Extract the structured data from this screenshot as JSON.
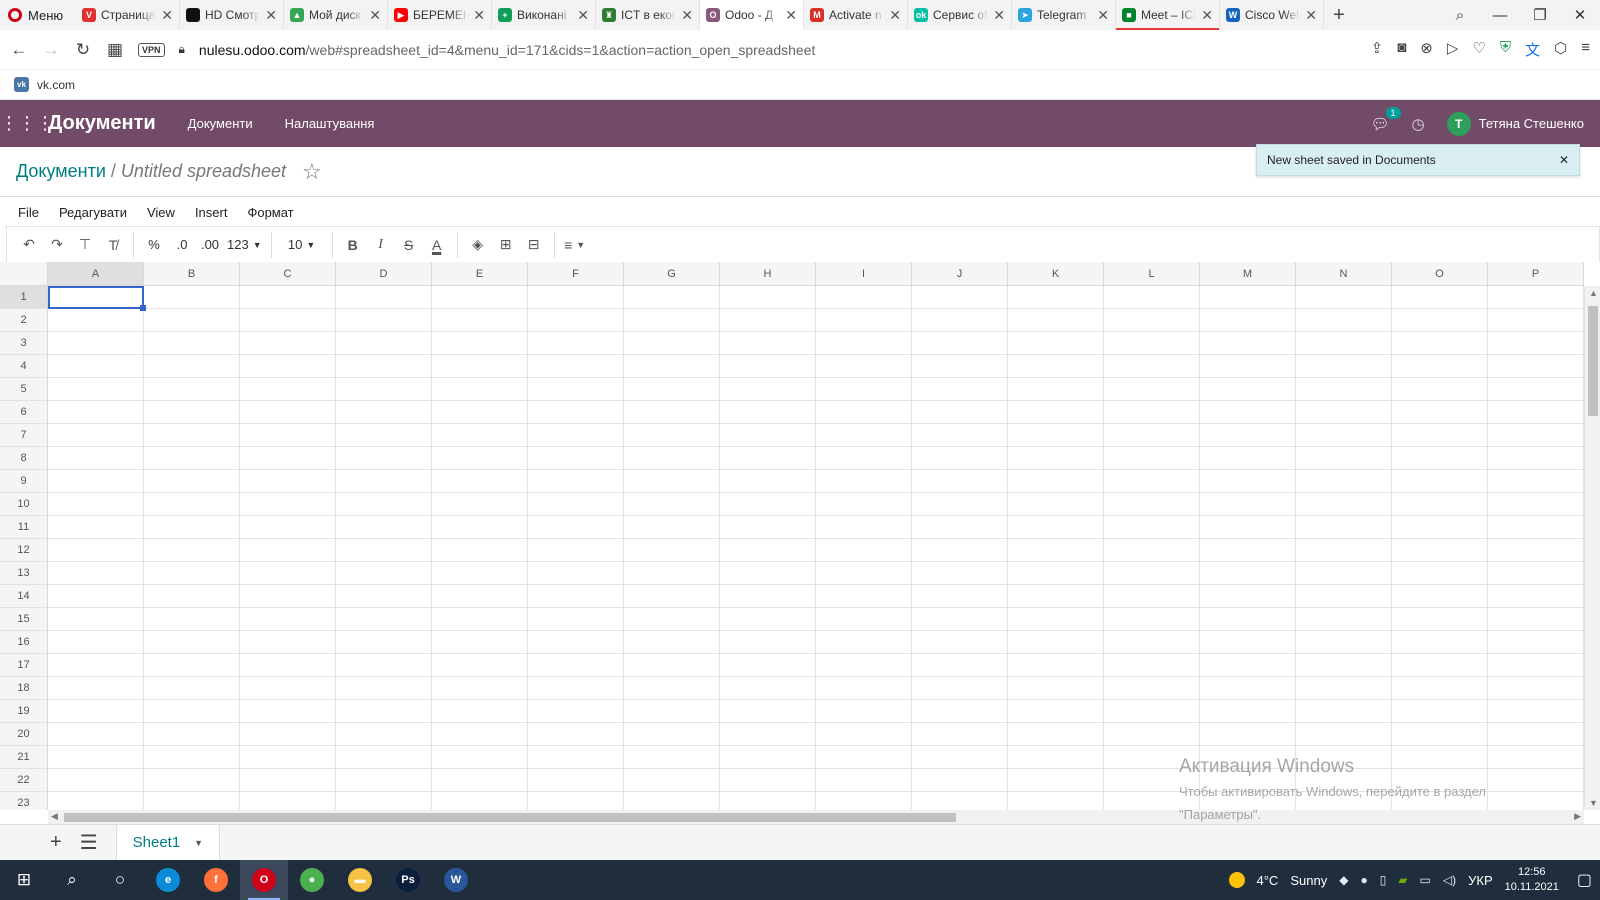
{
  "browser": {
    "menu_label": "Меню",
    "tabs": [
      {
        "title": "Страница",
        "icon": "vivaldi-icon",
        "color": "#e0312e",
        "glyph": "V"
      },
      {
        "title": "HD Смотреть",
        "icon": "hd-icon",
        "color": "#111111",
        "glyph": ""
      },
      {
        "title": "Мой диск",
        "icon": "google-drive-icon",
        "color": "#34a853",
        "glyph": "▲"
      },
      {
        "title": "БЕРЕМЕНН",
        "icon": "youtube-icon",
        "color": "#ff0000",
        "glyph": "▶"
      },
      {
        "title": "Виконані",
        "icon": "sheets-icon",
        "color": "#0f9d58",
        "glyph": "+"
      },
      {
        "title": "ICT в екон",
        "icon": "shield-icon",
        "color": "#2e7d32",
        "glyph": "♜"
      },
      {
        "title": "Odoo - Д",
        "icon": "odoo-icon",
        "color": "#875a7b",
        "glyph": "O"
      },
      {
        "title": "Activate n",
        "icon": "gmail-icon",
        "color": "#d93025",
        "glyph": "M"
      },
      {
        "title": "Сервис of",
        "icon": "service-icon",
        "color": "#00bfa5",
        "glyph": "ok"
      },
      {
        "title": "Telegram",
        "icon": "telegram-icon",
        "color": "#2aa3df",
        "glyph": "➤"
      },
      {
        "title": "Meet – ICI",
        "icon": "meet-icon",
        "color": "#00832d",
        "glyph": "■"
      },
      {
        "title": "Cisco Web",
        "icon": "webex-icon",
        "color": "#1565c0",
        "glyph": "W"
      }
    ],
    "url_domain": "nulesu.odoo.com",
    "url_path": "/web#spreadsheet_id=4&menu_id=171&cids=1&action=action_open_spreadsheet",
    "vpn_label": "VPN",
    "bookmark": "vk.com"
  },
  "odoo": {
    "brand": "Документи",
    "menu": [
      "Документи",
      "Налаштування"
    ],
    "notification_count": "1",
    "user_initial": "T",
    "user_name": "Тетяна Стешенко",
    "breadcrumb_parent": "Документи",
    "breadcrumb_sep": "/",
    "breadcrumb_current": "Untitled spreadsheet",
    "toast_text": "New sheet saved in Documents"
  },
  "spreadsheet": {
    "menus": [
      "File",
      "Редагувати",
      "View",
      "Insert",
      "Формат"
    ],
    "toolbar": {
      "percent": "%",
      "dec_less": ".0",
      "dec_more": ".00",
      "num_format": "123",
      "font_size": "10"
    },
    "columns": [
      "A",
      "B",
      "C",
      "D",
      "E",
      "F",
      "G",
      "H",
      "I",
      "J",
      "K",
      "L",
      "M",
      "N",
      "O",
      "P"
    ],
    "rows": [
      "1",
      "2",
      "3",
      "4",
      "5",
      "6",
      "7",
      "8",
      "9",
      "10",
      "11",
      "12",
      "13",
      "14",
      "15",
      "16",
      "17",
      "18",
      "19",
      "20",
      "21",
      "22",
      "23"
    ],
    "active_cell": "A1",
    "sheet_name": "Sheet1"
  },
  "watermark": {
    "line1": "Активация Windows",
    "line2": "Чтобы активировать Windows, перейдите в раздел",
    "line3": "\"Параметры\"."
  },
  "taskbar": {
    "apps": [
      {
        "name": "edge-icon",
        "color": "#0c8bd6",
        "glyph": "e"
      },
      {
        "name": "firefox-icon",
        "color": "#ff7139",
        "glyph": "f"
      },
      {
        "name": "opera-icon",
        "color": "#d0021b",
        "glyph": "O",
        "active": true
      },
      {
        "name": "chrome-icon",
        "color": "#4caf50",
        "glyph": "●"
      },
      {
        "name": "file-explorer-icon",
        "color": "#f6c344",
        "glyph": "▬"
      },
      {
        "name": "photoshop-icon",
        "color": "#0b1e3c",
        "glyph": "Ps"
      },
      {
        "name": "word-icon",
        "color": "#2b579a",
        "glyph": "W"
      }
    ],
    "temperature": "4°C",
    "weather": "Sunny",
    "language": "УКР",
    "time": "12:56",
    "date": "10.11.2021"
  }
}
